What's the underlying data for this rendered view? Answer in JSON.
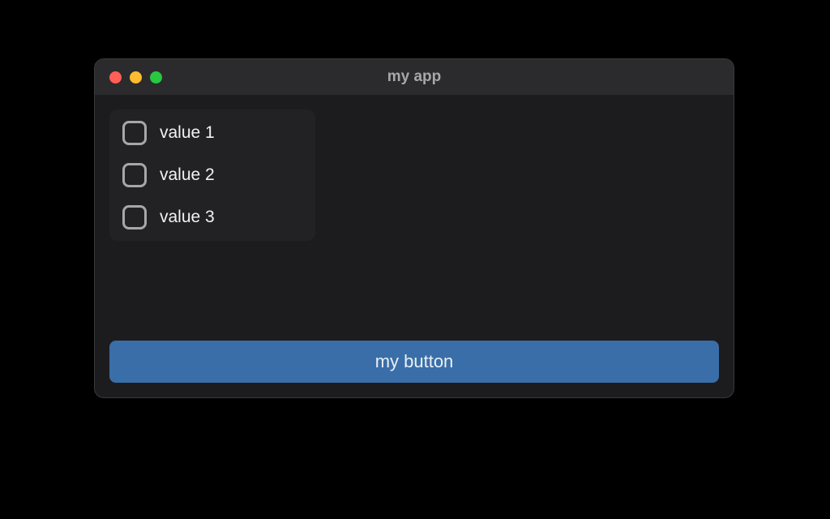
{
  "window": {
    "title": "my app"
  },
  "checkboxes": {
    "items": [
      {
        "label": "value 1"
      },
      {
        "label": "value 2"
      },
      {
        "label": "value 3"
      }
    ]
  },
  "actions": {
    "primary_label": "my button"
  },
  "colors": {
    "accent": "#3a6ea8",
    "window_bg": "#1c1c1e",
    "panel_bg": "#222224",
    "titlebar_bg": "#2b2b2d"
  }
}
